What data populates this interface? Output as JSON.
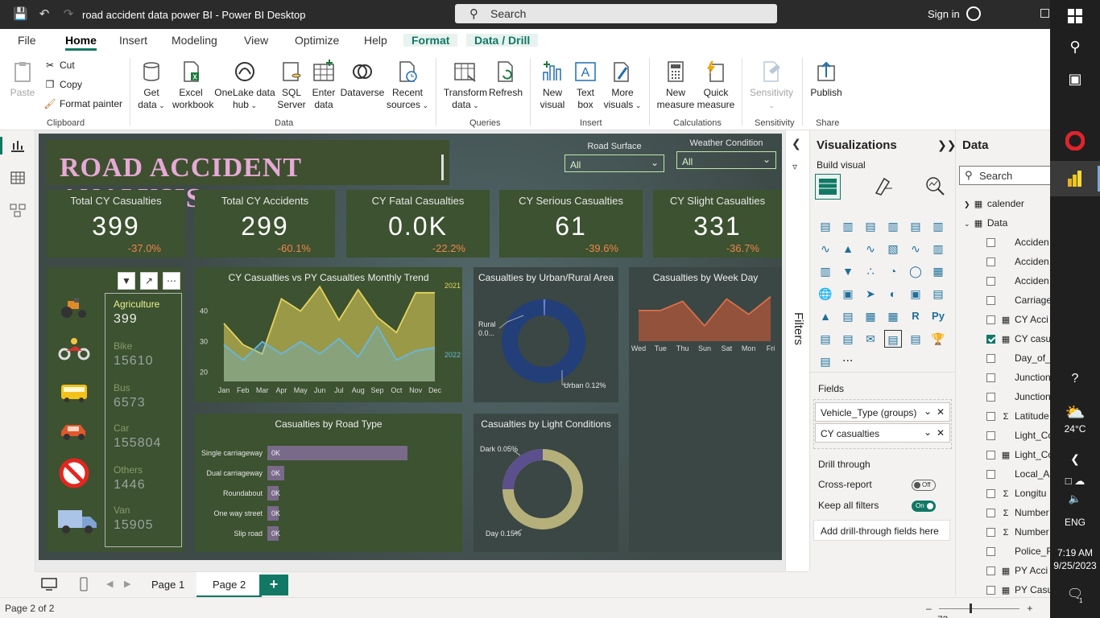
{
  "window": {
    "title": "road accident data power BI - Power BI Desktop",
    "search_placeholder": "Search",
    "signin": "Sign in"
  },
  "menu": [
    "File",
    "Home",
    "Insert",
    "Modeling",
    "View",
    "Optimize",
    "Help",
    "Format",
    "Data / Drill"
  ],
  "ribbon": {
    "paste": "Paste",
    "cut": "Cut",
    "copy": "Copy",
    "format_painter": "Format painter",
    "clipboard": "Clipboard",
    "get_data_1": "Get",
    "get_data_2": "data",
    "excel_1": "Excel",
    "excel_2": "workbook",
    "onelake_1": "OneLake data",
    "onelake_2": "hub",
    "sql_1": "SQL",
    "sql_2": "Server",
    "enter_1": "Enter",
    "enter_2": "data",
    "dataverse": "Dataverse",
    "recent_1": "Recent",
    "recent_2": "sources",
    "data_group": "Data",
    "transform_1": "Transform",
    "transform_2": "data",
    "refresh": "Refresh",
    "queries": "Queries",
    "new_visual_1": "New",
    "new_visual_2": "visual",
    "text_box_1": "Text",
    "text_box_2": "box",
    "more_visuals_1": "More",
    "more_visuals_2": "visuals",
    "insert": "Insert",
    "new_measure_1": "New",
    "new_measure_2": "measure",
    "quick_measure_1": "Quick",
    "quick_measure_2": "measure",
    "calculations": "Calculations",
    "sensitivity_btn": "Sensitivity",
    "sensitivity": "Sensitivity",
    "publish": "Publish",
    "share": "Share"
  },
  "report": {
    "title": "ROAD ACCIDENT ANALYSIS",
    "slicers": [
      {
        "label": "Road Surface",
        "value": "All"
      },
      {
        "label": "Weather Condition",
        "value": "All"
      }
    ],
    "cards": [
      {
        "label": "Total CY Casualties",
        "value": "399",
        "change": "-37.0%"
      },
      {
        "label": "Total CY Accidents",
        "value": "299",
        "change": "-60.1%"
      },
      {
        "label": "CY Fatal Casualties",
        "value": "0.0K",
        "change": "-22.2%"
      },
      {
        "label": "CY Serious Casualties",
        "value": "61",
        "change": "-39.6%"
      },
      {
        "label": "CY Slight Casualties",
        "value": "331",
        "change": "-36.7%"
      }
    ],
    "vehicles": [
      {
        "name": "Agriculture",
        "value": "399"
      },
      {
        "name": "Bike",
        "value": "15610"
      },
      {
        "name": "Bus",
        "value": "6573"
      },
      {
        "name": "Car",
        "value": "155804"
      },
      {
        "name": "Others",
        "value": "1446"
      },
      {
        "name": "Van",
        "value": "15905"
      }
    ],
    "trend_title": "CY Casualties vs PY Casualties Monthly Trend",
    "urban_title": "Casualties by Urban/Rural Area",
    "urban_labels": {
      "rural_1": "Rural",
      "rural_2": "0.0...",
      "urban": "Urban 0.12%"
    },
    "weekday_title": "Casualties by Week Day",
    "road_title": "Casualties by Road Type",
    "light_title": "Casualties by Light Conditions",
    "light_labels": {
      "dark": "Dark 0.05%",
      "day": "Day 0.15%"
    }
  },
  "chart_data": [
    {
      "type": "area",
      "title": "CY Casualties vs PY Casualties Monthly Trend",
      "categories": [
        "Jan",
        "Feb",
        "Mar",
        "Apr",
        "May",
        "Jun",
        "Jul",
        "Aug",
        "Sep",
        "Oct",
        "Nov",
        "Dec"
      ],
      "series": [
        {
          "name": "2021",
          "values": [
            36,
            29,
            26,
            44,
            40,
            48,
            37,
            47,
            38,
            33,
            46,
            46
          ]
        },
        {
          "name": "2022",
          "values": [
            29,
            24,
            30,
            26,
            30,
            26,
            31,
            25,
            35,
            24,
            27,
            28
          ]
        }
      ],
      "yticks": [
        20,
        30,
        40
      ],
      "ylim": [
        17,
        47
      ]
    },
    {
      "type": "pie",
      "title": "Casualties by Urban/Rural Area",
      "categories": [
        "Rural",
        "Urban"
      ],
      "values": [
        0.0,
        0.12
      ],
      "labels": [
        "Rural 0.0...",
        "Urban 0.12%"
      ]
    },
    {
      "type": "area",
      "title": "Casualties by Week Day",
      "categories": [
        "Wed",
        "Tue",
        "Thu",
        "Sun",
        "Sat",
        "Mon",
        "Fri"
      ],
      "values": [
        40,
        40,
        52,
        20,
        55,
        35,
        58
      ]
    },
    {
      "type": "bar",
      "title": "Casualties by Road Type",
      "categories": [
        "Single carriageway",
        "Dual carriageway",
        "Roundabout",
        "One way street",
        "Slip road"
      ],
      "values": [
        290,
        35,
        8,
        6,
        4
      ],
      "data_labels": [
        "0K",
        "0K",
        "0K",
        "0K",
        "0K"
      ]
    },
    {
      "type": "pie",
      "title": "Casualties by Light Conditions",
      "categories": [
        "Dark",
        "Day"
      ],
      "values": [
        0.05,
        0.15
      ],
      "labels": [
        "Dark 0.05%",
        "Day 0.15%"
      ]
    }
  ],
  "filters_label": "Filters",
  "visualizations": {
    "title": "Visualizations",
    "build": "Build visual",
    "fields": "Fields",
    "field_wells": [
      "Vehicle_Type (groups)",
      "CY casualties"
    ],
    "drill_through": "Drill through",
    "cross_report": "Cross-report",
    "cross_report_state": "Off",
    "keep_filters": "Keep all filters",
    "keep_filters_state": "On",
    "add_drill": "Add drill-through fields here",
    "more": "..."
  },
  "data_pane": {
    "title": "Data",
    "search": "Search",
    "tables": [
      "calender",
      "Data"
    ],
    "fields": [
      "Acciden",
      "Acciden",
      "Acciden",
      "Carriage",
      "CY Acci",
      "CY casu",
      "Day_of_",
      "Junction",
      "Junction",
      "Latitude",
      "Light_Co",
      "Light_Co",
      "Local_A",
      "Longitu",
      "Number",
      "Number",
      "Police_F",
      "PY Acci",
      "PY Casu"
    ]
  },
  "pages": {
    "tabs": [
      "Page 1",
      "Page 2"
    ],
    "add": "+",
    "status": "Page 2 of 2",
    "zoom": "73"
  },
  "taskbar": {
    "weather": "24°C",
    "lang": "ENG",
    "time": "7:19 AM",
    "date": "9/25/2023",
    "notif": "1"
  },
  "colors": {
    "accent": "#117865",
    "title_pink": "#e7a9d6",
    "panel_green": "#3c5230",
    "change_orange": "#f0844c",
    "cy_line": "#e6d35c",
    "py_line": "#6ab7e0",
    "weekday_fill": "#b0553a",
    "bar_fill": "#7a6a8a"
  }
}
